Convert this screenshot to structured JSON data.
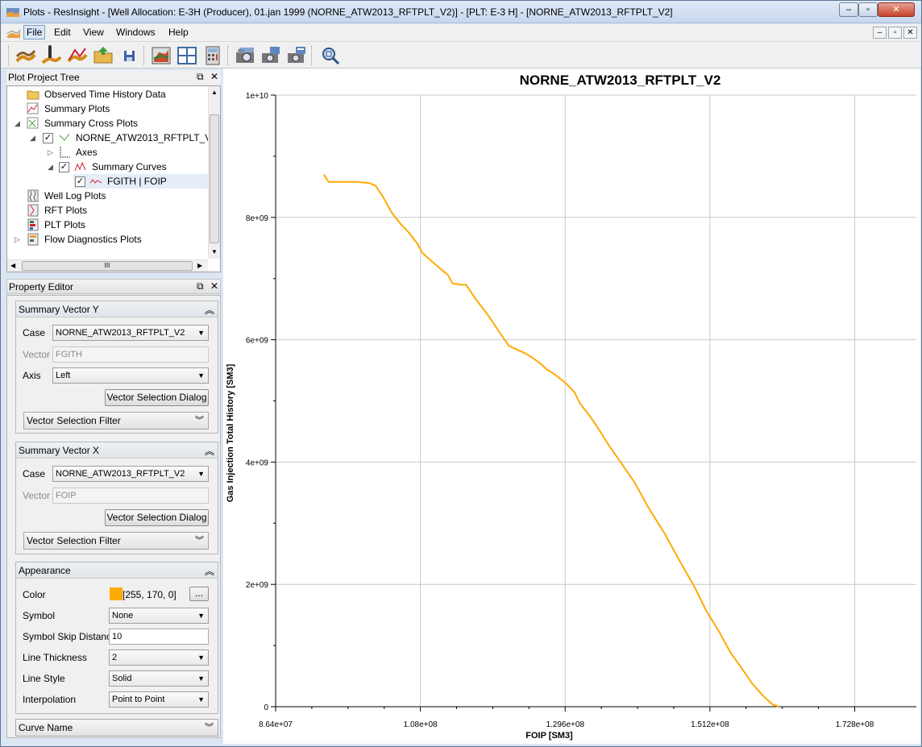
{
  "window": {
    "title": "Plots - ResInsight - [Well Allocation: E-3H (Producer), 01.jan 1999 (NORNE_ATW2013_RFTPLT_V2)] - [PLT: E-3 H] - [NORNE_ATW2013_RFTPLT_V2]",
    "minimize": "–",
    "restore": "▫",
    "close": "✕"
  },
  "menu": [
    "File",
    "Edit",
    "View",
    "Windows",
    "Help"
  ],
  "toolbar_icons": [
    "import-summary-case-icon",
    "well-info-icon",
    "summary-plot-icon",
    "open-project-icon",
    "save-project-icon",
    "3d-view-icon",
    "tile-windows-icon",
    "calculator-icon",
    "snapshot-icon",
    "snapshot-all-icon",
    "snapshot-to-file-icon",
    "zoom-all-icon"
  ],
  "tree": {
    "title": "Plot Project Tree",
    "items": [
      {
        "label": "Observed Time History Data"
      },
      {
        "label": "Summary Plots"
      },
      {
        "label": "Summary Cross Plots"
      },
      {
        "label": "NORNE_ATW2013_RFTPLT_V2"
      },
      {
        "label": "Axes"
      },
      {
        "label": "Summary Curves"
      },
      {
        "label": "FGITH | FOIP"
      },
      {
        "label": "Well Log Plots"
      },
      {
        "label": "RFT Plots"
      },
      {
        "label": "PLT Plots"
      },
      {
        "label": "Flow Diagnostics Plots"
      }
    ],
    "hscroll_grip": "III"
  },
  "property_editor": {
    "title": "Property Editor",
    "vector_y": {
      "header": "Summary Vector Y",
      "case_label": "Case",
      "case_value": "NORNE_ATW2013_RFTPLT_V2",
      "vector_label": "Vector",
      "vector_value": "FGITH",
      "axis_label": "Axis",
      "axis_value": "Left",
      "dialog_button": "Vector Selection Dialog",
      "filter_label": "Vector Selection Filter"
    },
    "vector_x": {
      "header": "Summary Vector X",
      "case_label": "Case",
      "case_value": "NORNE_ATW2013_RFTPLT_V2",
      "vector_label": "Vector",
      "vector_value": "FOIP",
      "dialog_button": "Vector Selection Dialog",
      "filter_label": "Vector Selection Filter"
    },
    "appearance": {
      "header": "Appearance",
      "color_label": "Color",
      "color_hex": "#ffaa00",
      "color_value": "[255, 170, 0]",
      "color_button": "...",
      "symbol_label": "Symbol",
      "symbol_value": "None",
      "skip_label": "Symbol Skip Distance",
      "skip_value": "10",
      "thickness_label": "Line Thickness",
      "thickness_value": "2",
      "style_label": "Line Style",
      "style_value": "Solid",
      "interp_label": "Interpolation",
      "interp_value": "Point to Point"
    },
    "curve_name": "Curve Name"
  },
  "chart_data": {
    "type": "line",
    "title": "NORNE_ATW2013_RFTPLT_V2",
    "xlabel": "FOIP [SM3]",
    "ylabel": "Gas Injection Total History [SM3]",
    "xlim": [
      86400000,
      182000000
    ],
    "ylim": [
      0,
      10000000000
    ],
    "x_ticks": [
      86400000,
      108000000,
      129600000,
      151200000,
      172800000
    ],
    "x_tick_labels": [
      "8.64e+07",
      "1.08e+08",
      "1.296e+08",
      "1.512e+08",
      "1.728e+08"
    ],
    "y_ticks": [
      0,
      2000000000,
      4000000000,
      6000000000,
      8000000000,
      10000000000
    ],
    "y_tick_labels": [
      "0",
      "2e+09",
      "4e+09",
      "6e+09",
      "8e+09",
      "1e+10"
    ],
    "grid": true,
    "line_color": "#ffaa00",
    "series": [
      {
        "x": [
          93600000,
          94300000,
          96000000,
          98600000,
          100400000,
          101300000,
          102400000,
          103700000,
          105000000,
          106200000,
          107500000,
          108300000,
          109700000,
          111000000,
          112100000,
          112800000,
          114000000,
          114800000,
          116300000,
          118100000,
          119700000,
          121200000,
          122800000,
          123600000,
          124800000,
          125800000,
          126800000,
          128200000,
          129600000,
          131000000,
          131800000,
          133500000,
          134700000,
          136200000,
          138000000,
          140000000,
          142000000,
          144500000,
          146600000,
          148900000,
          150600000,
          152600000,
          154300000,
          156000000,
          157500000,
          159100000,
          160500000,
          161500000
        ],
        "y": [
          8700000000,
          8580000000,
          8580000000,
          8580000000,
          8560000000,
          8520000000,
          8340000000,
          8080000000,
          7900000000,
          7760000000,
          7580000000,
          7420000000,
          7280000000,
          7160000000,
          7060000000,
          6920000000,
          6900000000,
          6900000000,
          6660000000,
          6400000000,
          6140000000,
          5900000000,
          5820000000,
          5780000000,
          5700000000,
          5620000000,
          5520000000,
          5420000000,
          5300000000,
          5140000000,
          4960000000,
          4720000000,
          4520000000,
          4260000000,
          3980000000,
          3660000000,
          3260000000,
          2820000000,
          2400000000,
          1960000000,
          1580000000,
          1220000000,
          880000000,
          620000000,
          380000000,
          180000000,
          40000000,
          0
        ]
      }
    ]
  }
}
